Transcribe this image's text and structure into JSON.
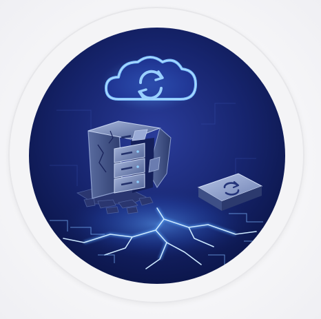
{
  "image": {
    "kind": "illustration",
    "colors": {
      "page_background": "#f6f6f8",
      "ring": "#f4f4f6",
      "disc_center": "#1e2f86",
      "disc_edge": "#0a1446",
      "glow": "#58a2ff",
      "server": "#7d8fb8",
      "drive": "#8a9bc4"
    },
    "icons": [
      "cloud-sync-icon",
      "broken-server-icon",
      "backup-drive-icon",
      "crack-lightning-icon"
    ]
  }
}
